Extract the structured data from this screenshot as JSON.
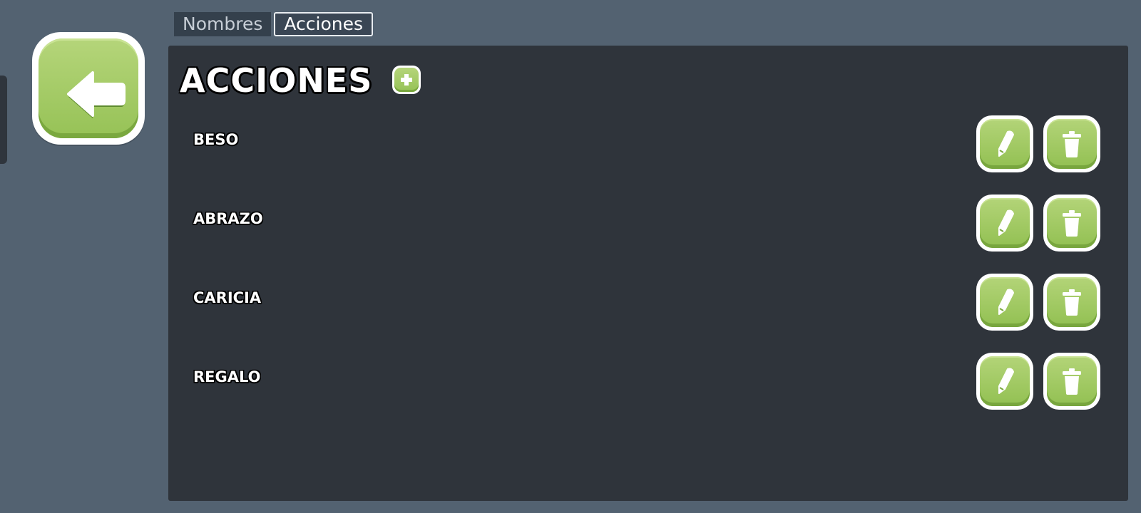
{
  "tabs": [
    {
      "label": "Nombres",
      "active": false
    },
    {
      "label": "Acciones",
      "active": true
    }
  ],
  "panel": {
    "title": "ACCIONES"
  },
  "actions": [
    {
      "name": "BESO"
    },
    {
      "name": "ABRAZO"
    },
    {
      "name": "CARICIA"
    },
    {
      "name": "REGALO"
    }
  ],
  "icons": {
    "back": "arrow-left-icon",
    "add": "plus-icon",
    "edit": "pencil-icon",
    "delete": "trash-icon"
  },
  "colors": {
    "background": "#536271",
    "panel": "#2f343b",
    "button_green": "#a3cb64",
    "button_border": "#ffffff"
  }
}
